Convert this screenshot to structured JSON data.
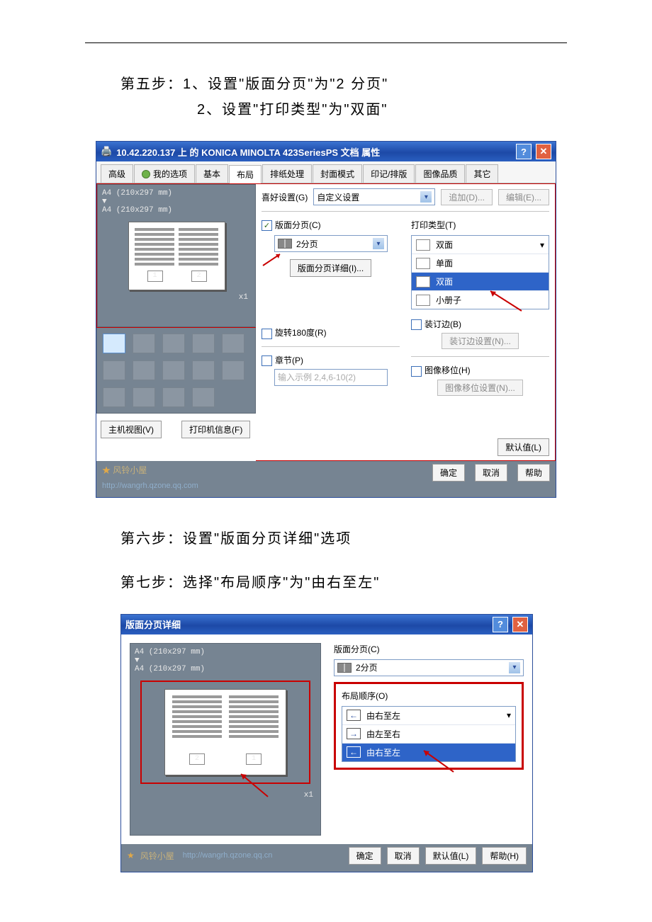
{
  "step5": {
    "line1": "第五步：1、设置\"版面分页\"为\"2 分页\"",
    "line2": "2、设置\"打印类型\"为\"双面\""
  },
  "step6": "第六步：设置\"版面分页详细\"选项",
  "step7": "第七步：选择\"布局顺序\"为\"由右至左\"",
  "dialog1": {
    "title": "10.42.220.137 上 的 KONICA MINOLTA 423SeriesPS 文档 属性",
    "tabs": [
      "高级",
      "我的选项",
      "基本",
      "布局",
      "排纸处理",
      "封面模式",
      "印记/排版",
      "图像品质",
      "其它"
    ],
    "activeTab": "布局",
    "paperFrom": "A4 (210x297 mm)",
    "paperTo": "A4 (210x297 mm)",
    "x1": "x1",
    "favLabel": "喜好设置(G)",
    "favValue": "自定义设置",
    "add": "追加(D)...",
    "edit": "编辑(E)...",
    "layoutCheck": "版面分页(C)",
    "layoutValue": "2分页",
    "layoutDetail": "版面分页详细(I)...",
    "rotate": "旋转180度(R)",
    "printTypeLabel": "打印类型(T)",
    "printTypeValue": "双面",
    "printTypeOptions": [
      "单面",
      "双面",
      "小册子"
    ],
    "bindEdge": "装订边(B)",
    "bindSetting": "装订边设置(N)...",
    "chapter": "章节(P)",
    "chapterHint": "输入示例 2,4,6-10(2)",
    "imageShift": "图像移位(H)",
    "imageShiftSetting": "图像移位设置(N)...",
    "hostView": "主机视图(V)",
    "printerInfo": "打印机信息(F)",
    "defaultBtn": "默认值(L)",
    "ok": "确定",
    "cancel": "取消",
    "helpBtn": "帮助",
    "watermark": "风铃小屋",
    "watermarkUrl": "http://wangrh.qzone.qq.com"
  },
  "dialog2": {
    "title": "版面分页详细",
    "paperFrom": "A4 (210x297 mm)",
    "paperTo": "A4 (210x297 mm)",
    "x1": "x1",
    "layoutLabel": "版面分页(C)",
    "layoutValue": "2分页",
    "orderLabel": "布局顺序(O)",
    "orderValue": "由右至左",
    "orderOptions": [
      "由左至右",
      "由右至左"
    ],
    "ok": "确定",
    "cancel": "取消",
    "defaultBtn": "默认值(L)",
    "help": "帮助(H)",
    "watermark": "风铃小屋",
    "watermarkUrl": "http://wangrh.qzone.qq.cn"
  }
}
